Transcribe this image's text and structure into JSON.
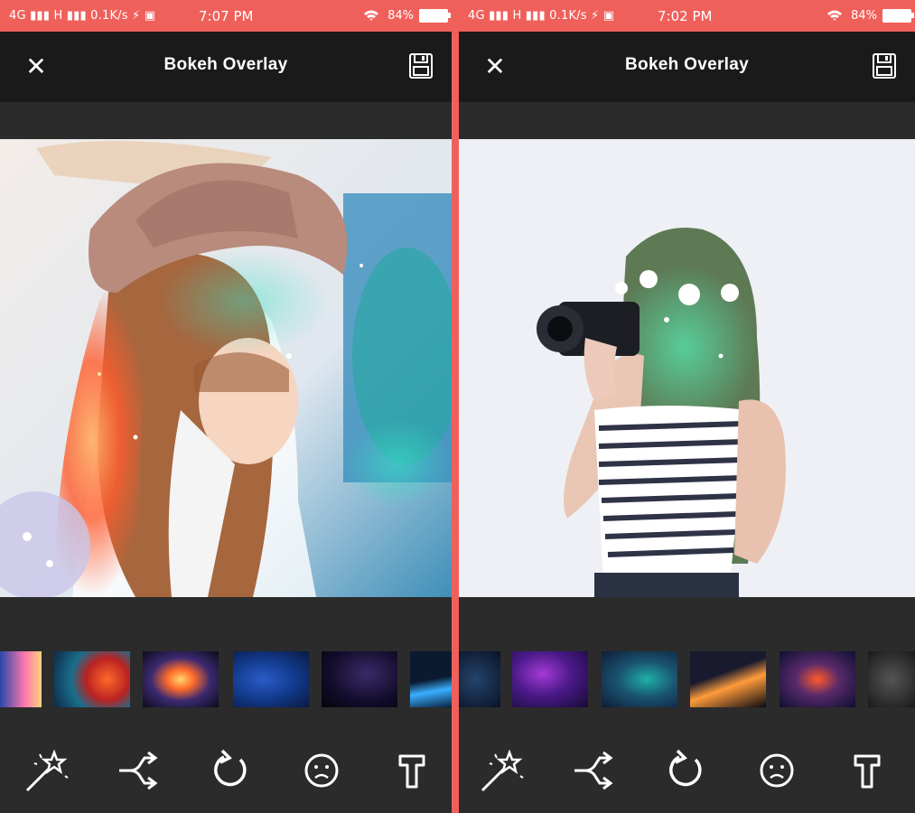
{
  "screens": [
    {
      "status": {
        "network": "4G ▮▮▮ H ▮▮▮ 0.1K/s ⚡ ▣",
        "time": "7:07 PM",
        "battery": "84%"
      },
      "header": {
        "title": "Bokeh Overlay"
      },
      "photo": {
        "subject": "woman-in-hat",
        "overlay_color": "#ff6a3a"
      },
      "thumbnails": [
        "nebula-pink",
        "nebula-orange-teal",
        "nebula-orange",
        "deep-blue-stars",
        "dark-purple-stars",
        "planet-horizon"
      ]
    },
    {
      "status": {
        "network": "4G ▮▮▮ H ▮▮▮ 0.1K/s ⚡ ▣",
        "time": "7:02 PM",
        "battery": "84%"
      },
      "header": {
        "title": "Bokeh Overlay"
      },
      "photo": {
        "subject": "woman-with-camera",
        "overlay_color": "#2fd6a0"
      },
      "thumbnails": [
        "navy-stars",
        "purple-galaxy",
        "teal-nebula",
        "comet-orange",
        "red-blue-nebula",
        "grey-stars"
      ]
    }
  ],
  "colors": {
    "accent": "#f0605b",
    "toolbar": "#1a1a1a",
    "panel": "#2b2b2b"
  },
  "tool_icons": [
    "magic-wand-icon",
    "shuffle-icon",
    "rotate-icon",
    "sad-face-icon",
    "text-icon"
  ]
}
